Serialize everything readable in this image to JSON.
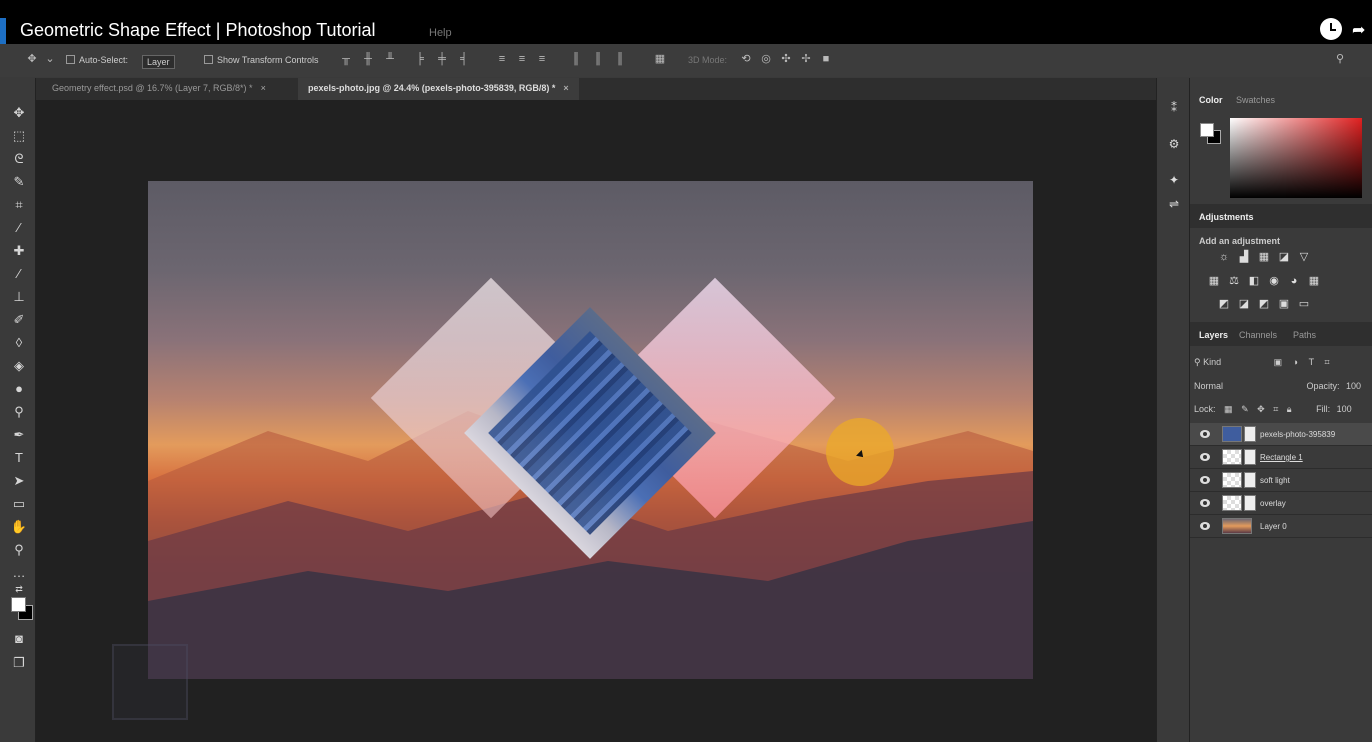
{
  "video": {
    "title": "Geometric Shape Effect | Photoshop Tutorial"
  },
  "menu": {
    "help": "Help"
  },
  "options_bar": {
    "auto_select_label": "Auto-Select:",
    "auto_select_value": "Layer",
    "show_transform": "Show Transform Controls",
    "mode_3d": "3D Mode:"
  },
  "document_tabs": [
    {
      "label": "Geometry effect.psd @ 16.7% (Layer 7, RGB/8*) *",
      "active": false
    },
    {
      "label": "pexels-photo.jpg @ 24.4% (pexels-photo-395839, RGB/8) *",
      "active": true
    }
  ],
  "tab_close": "×",
  "color_panel": {
    "tabs": [
      "Color",
      "Swatches"
    ],
    "fg": "#ffffff",
    "bg": "#000000",
    "hue": "#e02020"
  },
  "adjustments_panel": {
    "title": "Adjustments",
    "subtitle": "Add an adjustment"
  },
  "layers_panel": {
    "tabs": [
      "Layers",
      "Channels",
      "Paths"
    ],
    "filter_kind": "Kind",
    "blend_mode": "Normal",
    "opacity_label": "Opacity:",
    "opacity_value": "100",
    "lock_label": "Lock:",
    "fill_label": "Fill:",
    "fill_value": "100",
    "layers": [
      {
        "name": "pexels-photo-395839",
        "selected": true
      },
      {
        "name": "Rectangle 1",
        "selected": false
      },
      {
        "name": "soft light",
        "selected": false
      },
      {
        "name": "overlay",
        "selected": false
      },
      {
        "name": "Layer 0",
        "selected": false
      }
    ]
  },
  "colors": {
    "accent": "#1d6fc4",
    "canvas_bg": "#212121",
    "panel_bg": "#3a3a3a",
    "cursor_highlight": "#ebaa28"
  }
}
